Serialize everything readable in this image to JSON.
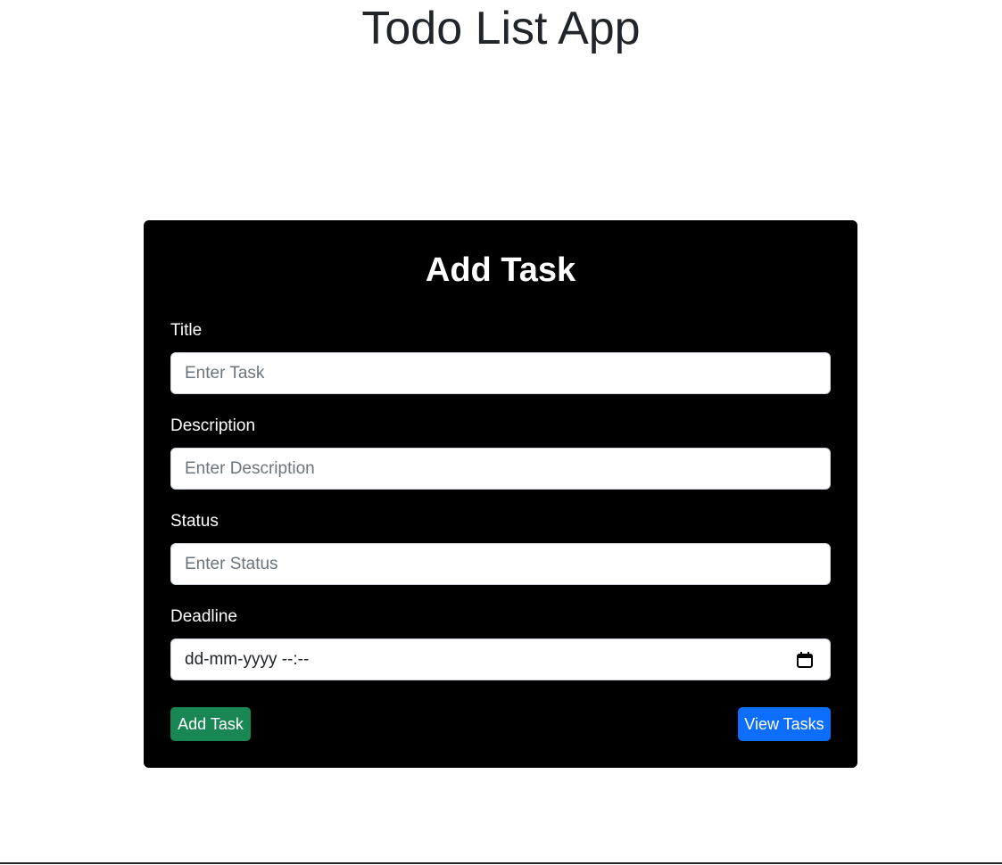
{
  "app": {
    "title": "Todo List App"
  },
  "form": {
    "heading": "Add Task",
    "fields": {
      "title": {
        "label": "Title",
        "placeholder": "Enter Task",
        "value": ""
      },
      "description": {
        "label": "Description",
        "placeholder": "Enter Description",
        "value": ""
      },
      "status": {
        "label": "Status",
        "placeholder": "Enter Status",
        "value": ""
      },
      "deadline": {
        "label": "Deadline",
        "display": "dd-mm-yyyy --:--",
        "icon": "calendar-icon"
      }
    },
    "buttons": {
      "add_label": "Add Task",
      "view_label": "View Tasks"
    }
  },
  "colors": {
    "card_bg": "#000000",
    "add_button": "#198754",
    "view_button": "#0d6efd",
    "title_text": "#212529"
  }
}
